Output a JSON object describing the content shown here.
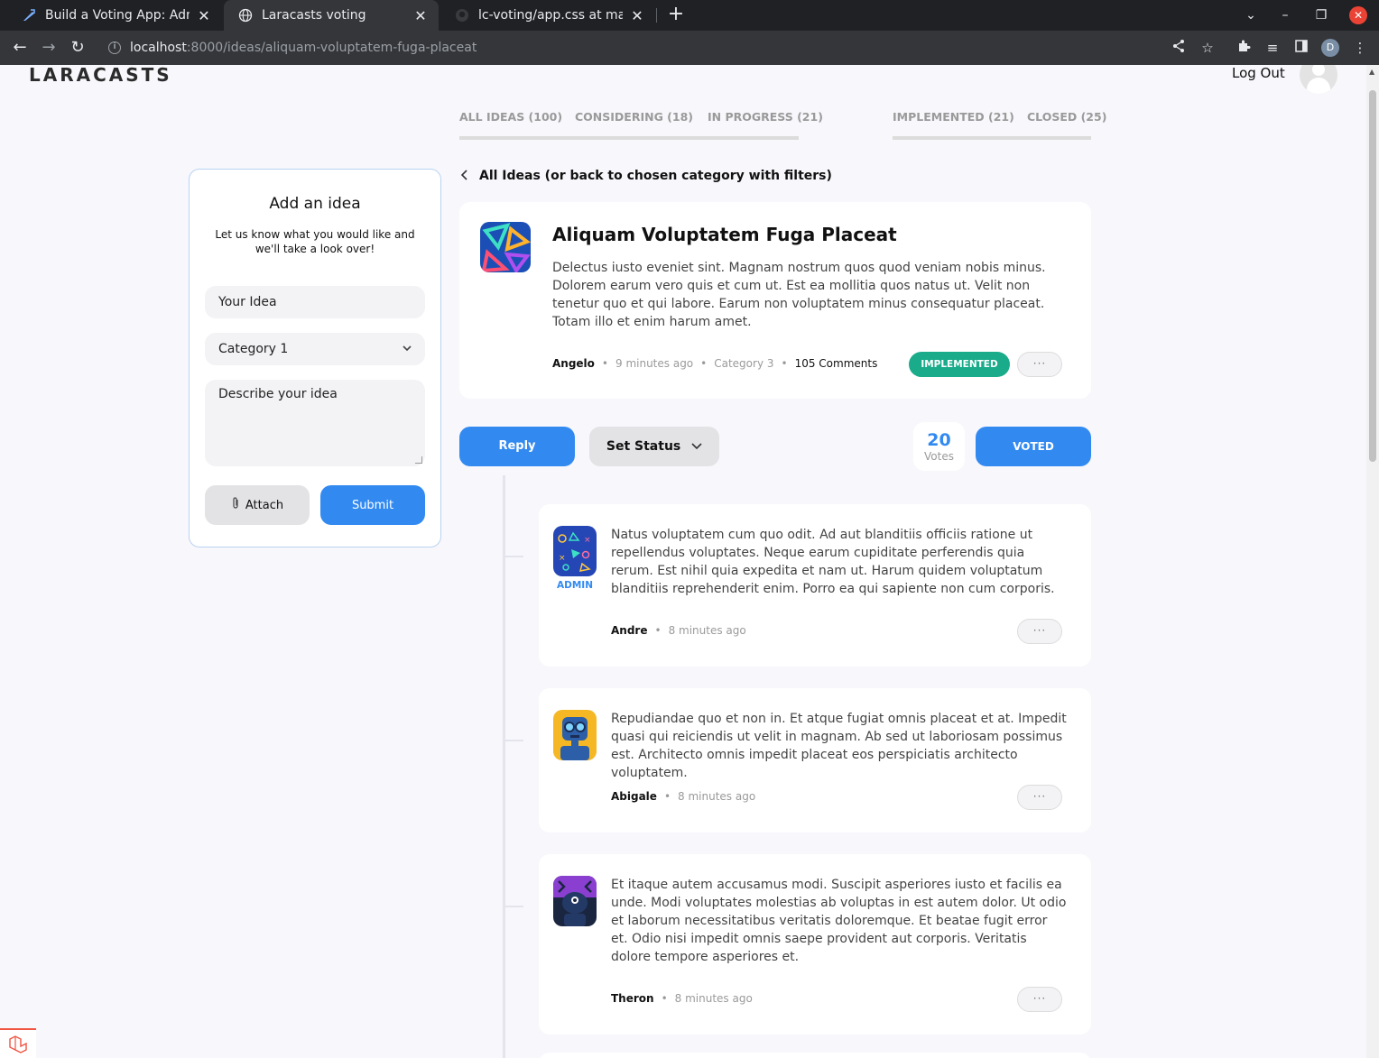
{
  "browser": {
    "tabs": [
      {
        "title": "Build a Voting App: Admin",
        "active": false
      },
      {
        "title": "Laracasts voting",
        "active": true
      },
      {
        "title": "lc-voting/app.css at master",
        "active": false
      }
    ],
    "url_host": "localhost",
    "url_path": ":8000/ideas/aliquam-voluptatem-fuga-placeat",
    "profile_initial": "D"
  },
  "header": {
    "logo": "LARACASTS",
    "logout": "Log Out"
  },
  "filters": [
    {
      "label": "ALL IDEAS (100)"
    },
    {
      "label": "CONSIDERING (18)"
    },
    {
      "label": "IN PROGRESS (21)"
    },
    {
      "label": "IMPLEMENTED (21)"
    },
    {
      "label": "CLOSED (25)"
    }
  ],
  "add_idea": {
    "title": "Add an idea",
    "subtitle": "Let us know what you would like and we'll take a look over!",
    "idea_placeholder": "Your Idea",
    "category_value": "Category 1",
    "description_placeholder": "Describe your idea",
    "attach_label": "Attach",
    "submit_label": "Submit"
  },
  "back_link": "All Ideas (or back to chosen category with filters)",
  "idea": {
    "title": "Aliquam Voluptatem Fuga Placeat",
    "body": "Delectus iusto eveniet sint. Magnam nostrum quos quod veniam nobis minus. Dolorem earum vero quis et cum ut. Est ea mollitia quos natus ut. Velit non tenetur quo et qui labore. Earum non voluptatem minus consequatur placeat. Totam illo et enim harum amet.",
    "author": "Angelo",
    "time": "9 minutes ago",
    "category": "Category 3",
    "comments": "105 Comments",
    "status": "IMPLEMENTED",
    "status_color": "#1aab8b",
    "more": "···"
  },
  "actions": {
    "reply": "Reply",
    "set_status": "Set Status",
    "votes_count": "20",
    "votes_label": "Votes",
    "voted": "VOTED",
    "accent": "#328af1"
  },
  "comments": [
    {
      "body": "Natus voluptatem cum quo odit. Ad aut blanditiis officiis ratione ut repellendus voluptates. Neque earum cupiditate perferendis quia rerum. Est nihil quia expedita et nam ut. Harum quidem voluptatum blanditiis reprehenderit enim. Porro ea qui sapiente non cum corporis.",
      "author": "Andre",
      "time": "8 minutes ago",
      "badge": "ADMIN"
    },
    {
      "body": "Repudiandae quo et non in. Et atque fugiat omnis placeat et at. Impedit quasi qui reiciendis ut velit in magnam. Ab sed ut laboriosam possimus est. Architecto omnis impedit placeat eos perspiciatis architecto voluptatem.",
      "author": "Abigale",
      "time": "8 minutes ago"
    },
    {
      "body": "Et itaque autem accusamus modi. Suscipit asperiores iusto et facilis ea unde. Modi voluptates molestias ab voluptas in est autem dolor. Ut odio et laborum necessitatibus veritatis doloremque. Et beatae fugit error et. Odio nisi impedit omnis saepe provident aut corporis. Veritatis dolore tempore asperiores et.",
      "author": "Theron",
      "time": "8 minutes ago"
    }
  ],
  "separator": "•"
}
